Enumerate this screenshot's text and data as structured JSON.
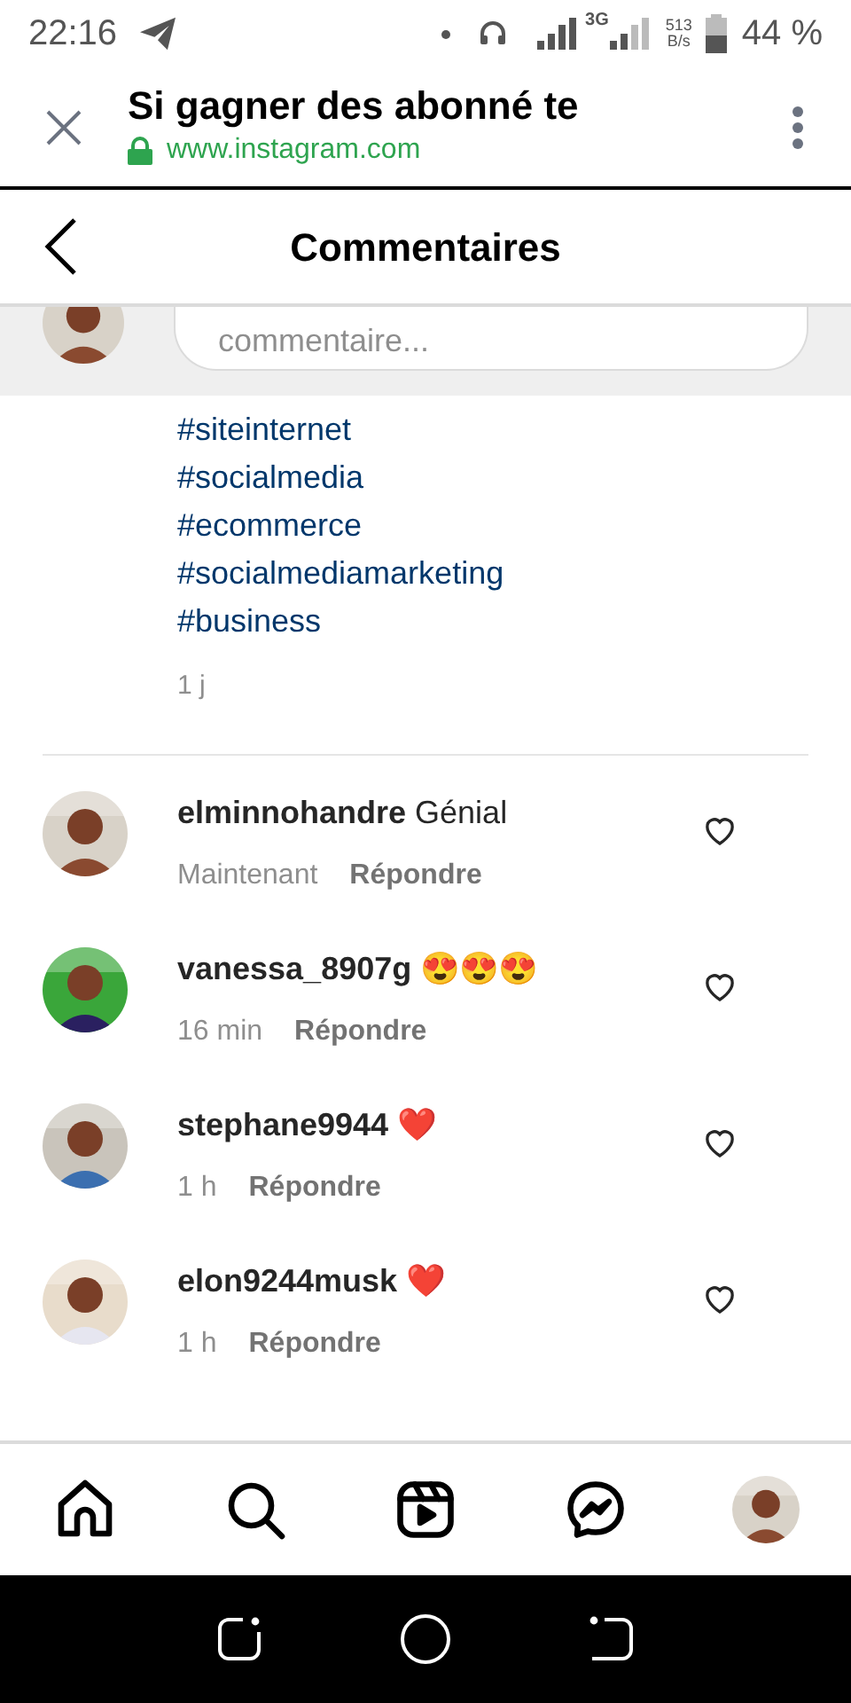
{
  "status_bar": {
    "time": "22:16",
    "network": "3G",
    "speed_value": "513",
    "speed_unit": "B/s",
    "battery": "44 %"
  },
  "browser_bar": {
    "title": "Si gagner des abonné te",
    "url": "www.instagram.com"
  },
  "header": {
    "title": "Commentaires"
  },
  "comment_input": {
    "placeholder": "commentaire..."
  },
  "caption": {
    "hashtags": [
      "#siteinternet",
      "#socialmedia",
      "#ecommerce",
      "#socialmediamarketing",
      "#business"
    ],
    "time": "1 j"
  },
  "comments": [
    {
      "username": "elminnohandre",
      "text": "Génial",
      "time": "Maintenant",
      "reply": "Répondre",
      "liked": false
    },
    {
      "username": "vanessa_8907g",
      "text": "😍😍😍",
      "time": "16 min",
      "reply": "Répondre",
      "liked": false
    },
    {
      "username": "stephane9944",
      "text": "❤️",
      "time": "1 h",
      "reply": "Répondre",
      "liked": false
    },
    {
      "username": "elon9244musk",
      "text": "❤️",
      "time": "1 h",
      "reply": "Répondre",
      "liked": false
    }
  ],
  "bottom_nav": [
    {
      "kind": "home",
      "selected": false
    },
    {
      "kind": "search",
      "selected": false
    },
    {
      "kind": "reels",
      "selected": false
    },
    {
      "kind": "messenger",
      "selected": false
    },
    {
      "kind": "profile",
      "selected": false
    }
  ]
}
